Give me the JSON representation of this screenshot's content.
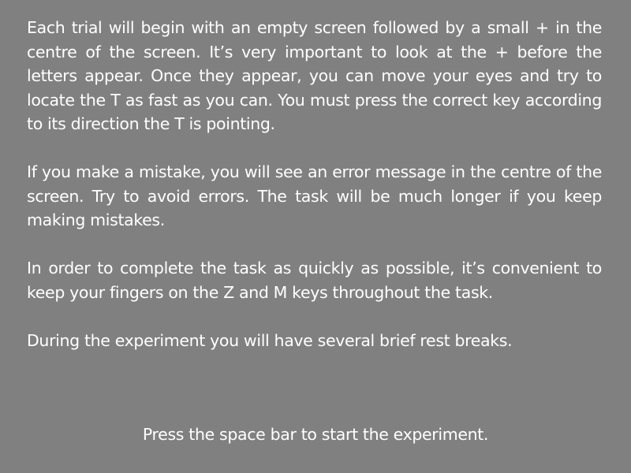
{
  "instructions": {
    "paragraph_1": "Each trial will begin with an empty screen followed by a small + in the centre of the screen. It’s very important to look at the + before the letters appear. Once they appear, you can move your eyes and try to locate the T as fast as you can. You must press the correct key according to its direction the T is pointing.",
    "paragraph_2": "If you make a mistake, you will see an error message in the centre of the screen. Try to avoid errors. The task will be much longer if you keep making mistakes.",
    "paragraph_3": "In order to complete the task as quickly as possible, it’s convenient to keep your fingers on the Z and M keys throughout the task.",
    "paragraph_4": "During the experiment you will have several brief rest breaks."
  },
  "prompt": "Press the space bar to start the experiment.",
  "colors": {
    "background": "#808080",
    "text": "#ffffff"
  }
}
